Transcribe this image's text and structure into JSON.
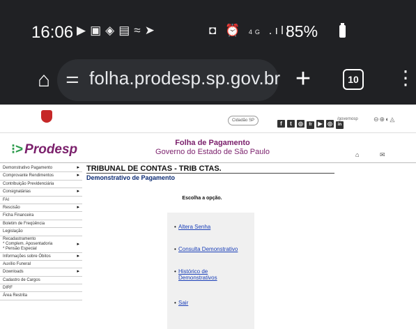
{
  "status_bar": {
    "time": "16:06",
    "notification_icons": [
      "youtube-icon",
      "gallery-icon",
      "binance-icon",
      "news-icon",
      "ifood-icon",
      "telegram-icon"
    ],
    "system_icons": [
      "nfc-icon",
      "alarm-icon",
      "4g-icon",
      "signal-icon"
    ],
    "network": "4G",
    "battery": "85%"
  },
  "browser": {
    "url": "folha.prodesp.sp.gov.br",
    "tab_count": "10"
  },
  "gov_bar": {
    "cidadao": "Cidadão SP",
    "social_icons": [
      "facebook-icon",
      "twitter-icon",
      "instagram-icon",
      "flickr-icon",
      "youtube-icon",
      "instagram-alt-icon",
      "linkedin-icon"
    ],
    "social_glyphs": [
      "f",
      "t",
      "◎",
      "fr",
      "▶",
      "◎",
      "in"
    ],
    "handle": "/governosp"
  },
  "header": {
    "logo": "Prodesp",
    "title": "Folha de Pagamento",
    "subtitle": "Governo do Estado de São Paulo"
  },
  "sidebar": {
    "items": [
      {
        "label": "Demonstrativo Pagamento",
        "arrow": "▸"
      },
      {
        "label": "Comprovante Rendimentos",
        "arrow": "▸"
      },
      {
        "label": "Contribuição Previdenciária",
        "arrow": ""
      },
      {
        "label": "Consignatárias",
        "arrow": "▸"
      },
      {
        "label": "FAI",
        "arrow": ""
      },
      {
        "label": "Rescisão",
        "arrow": "▸"
      },
      {
        "label": "Ficha Financeira",
        "arrow": ""
      },
      {
        "label": "Boletim de Freqüência",
        "arrow": ""
      },
      {
        "label": "Legislação",
        "arrow": ""
      },
      {
        "label": "Recadastramento\n* Complem. Aposentadoria\n* Pensão Especial",
        "arrow": "▸"
      },
      {
        "label": "Informações sobre Óbitos",
        "arrow": "▸"
      },
      {
        "label": "Auxílio Funeral",
        "arrow": ""
      },
      {
        "label": "Downloads",
        "arrow": "▸"
      },
      {
        "label": "Cadastro de Cargos",
        "arrow": ""
      },
      {
        "label": "DIRF",
        "arrow": ""
      },
      {
        "label": "Área Restrita",
        "arrow": ""
      }
    ]
  },
  "main": {
    "org_title": "TRIBUNAL DE CONTAS - TRIB CTAS.",
    "doc_title": "Demonstrativo de Pagamento",
    "choose": "Escolha a opção.",
    "options": [
      {
        "label": "Altera Senha"
      },
      {
        "label": "Consulta Demonstrativo"
      },
      {
        "label": "Histórico de Demonstrativos"
      },
      {
        "label": "Sair"
      }
    ]
  }
}
